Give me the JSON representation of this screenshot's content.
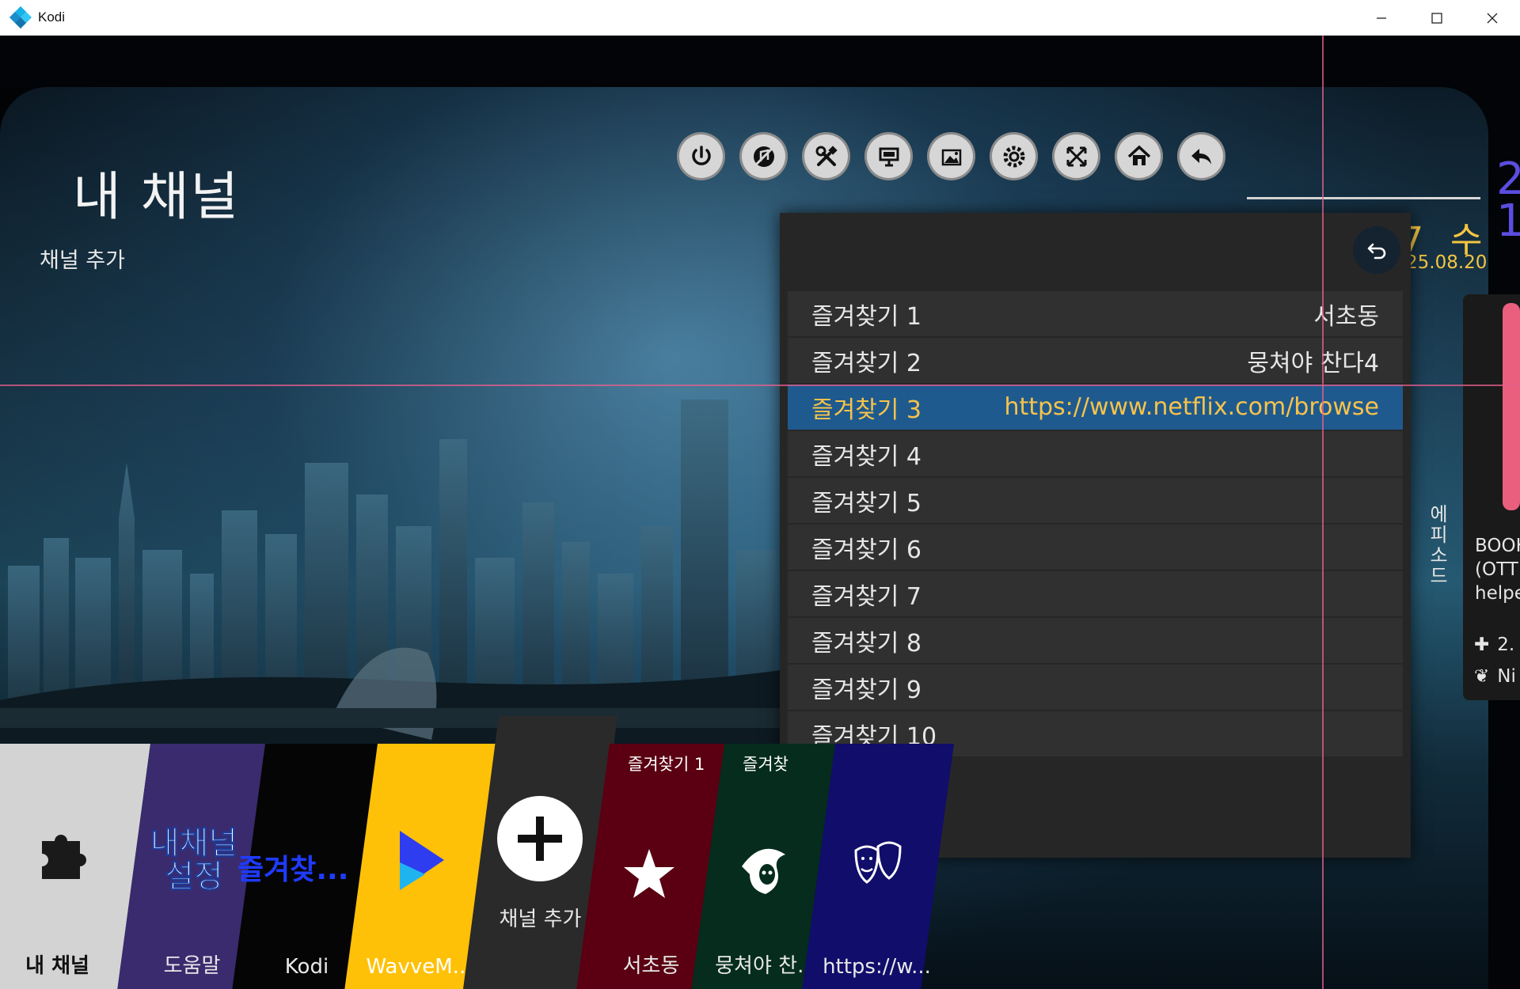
{
  "window": {
    "title": "Kodi",
    "controls": [
      "minimize",
      "maximize",
      "close"
    ]
  },
  "page": {
    "title": "내 채널",
    "subtitle": "채널 추가"
  },
  "topbar": {
    "icons": [
      "power-icon",
      "no-music-icon",
      "tools-icon",
      "presentation-icon",
      "picture-icon",
      "gears-icon",
      "fullscreen-icon",
      "home-icon",
      "back-arrow-icon"
    ]
  },
  "clock": {
    "day": "7 수",
    "date": "25.08.20",
    "num": "2\n1"
  },
  "info_panel": {
    "vertical_text": "에피소드",
    "text": "BOOK\n(OTT\nhelpe",
    "rows": [
      "2.",
      "Ni"
    ]
  },
  "favourites": {
    "items": [
      {
        "label": "즐겨찾기 1",
        "value": "서초동"
      },
      {
        "label": "즐겨찾기 2",
        "value": "뭉쳐야 찬다4"
      },
      {
        "label": "즐겨찾기 3",
        "value": "https://www.netflix.com/browse"
      },
      {
        "label": "즐겨찾기 4",
        "value": ""
      },
      {
        "label": "즐겨찾기 5",
        "value": ""
      },
      {
        "label": "즐겨찾기 6",
        "value": ""
      },
      {
        "label": "즐겨찾기 7",
        "value": ""
      },
      {
        "label": "즐겨찾기 8",
        "value": ""
      },
      {
        "label": "즐겨찾기 9",
        "value": ""
      },
      {
        "label": "즐겨찾기 10",
        "value": ""
      }
    ],
    "selected_index": 2
  },
  "menu": {
    "tiles": [
      {
        "label": "내 채널",
        "icon": "puzzle-icon",
        "color": "#d3d3d3",
        "label_color": "#111111"
      },
      {
        "label": "도움말",
        "icon_text": "내채널\n설정",
        "color": "#3a2b6e"
      },
      {
        "label": "Kodi",
        "icon_text": "즐겨찾...",
        "color": "#050505"
      },
      {
        "label": "WavveM...",
        "icon": "play-icon",
        "color": "#ffc107"
      },
      {
        "label": "채널 추가",
        "icon": "plus-icon",
        "color": "#2a2a2a"
      },
      {
        "label": "서초동",
        "top": "즐겨찾기 1",
        "icon": "star-icon",
        "color": "#5a0012"
      },
      {
        "label": "뭉쳐야 찬...",
        "top": "즐겨찾",
        "icon": "reaper-icon",
        "color": "#052c1c"
      },
      {
        "label": "https://w...",
        "icon": "theatre-icon",
        "color": "#100d6b"
      }
    ]
  }
}
